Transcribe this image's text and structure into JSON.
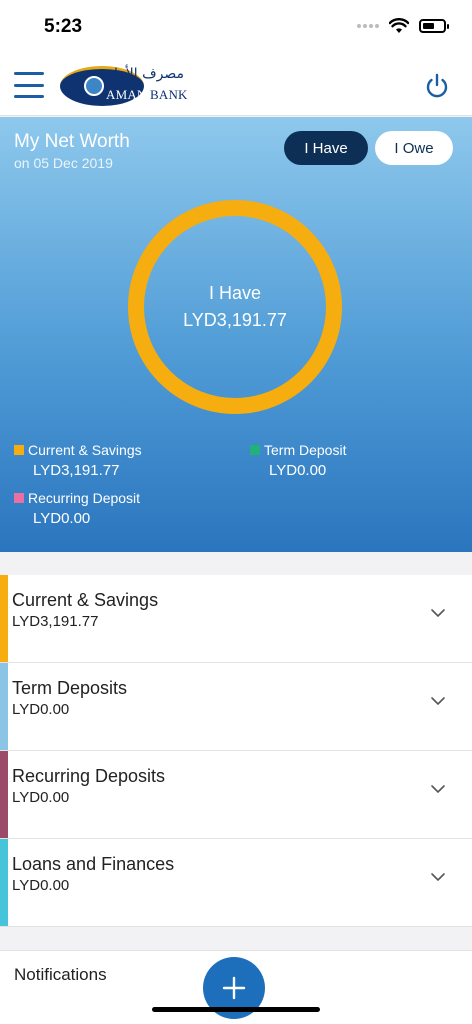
{
  "status_bar": {
    "time": "5:23"
  },
  "header": {
    "logo_arabic": "مصرف الأمان",
    "logo_text_prefix": "AMAN",
    "logo_text_suffix": "BANK"
  },
  "networth": {
    "title": "My Net Worth",
    "date": "on 05 Dec 2019",
    "toggle_have": "I Have",
    "toggle_owe": "I Owe",
    "center_label": "I Have",
    "center_value": "LYD3,191.77",
    "legend": [
      {
        "label": "Current & Savings",
        "value": "LYD3,191.77",
        "color": "#f5ad0f"
      },
      {
        "label": "Term Deposit",
        "value": "LYD0.00",
        "color": "#22b07b"
      },
      {
        "label": "Recurring Deposit",
        "value": "LYD0.00",
        "color": "#ea6fa2"
      }
    ],
    "ring_color": "#f5ad0f"
  },
  "accounts": [
    {
      "name": "Current & Savings",
      "amount": "LYD3,191.77",
      "color": "#f5ad0f"
    },
    {
      "name": "Term Deposits",
      "amount": "LYD0.00",
      "color": "#8cc4e6"
    },
    {
      "name": "Recurring Deposits",
      "amount": "LYD0.00",
      "color": "#9b4a68"
    },
    {
      "name": "Loans and Finances",
      "amount": "LYD0.00",
      "color": "#45c4da"
    }
  ],
  "notifications": {
    "title": "Notifications"
  },
  "colors": {
    "brand": "#1b5ea6",
    "navy": "#0d2f55",
    "fab": "#1d6fbb"
  }
}
